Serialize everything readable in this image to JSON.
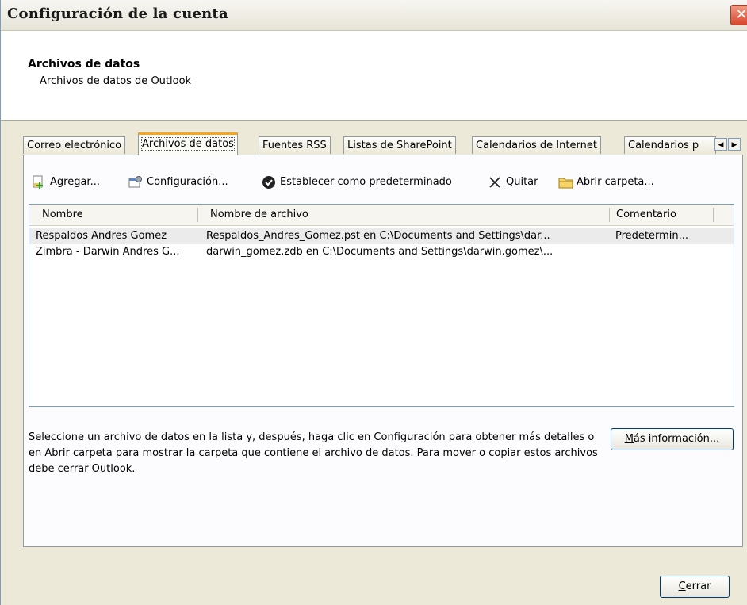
{
  "window": {
    "title": "Configuración de la cuenta",
    "close_glyph": "✕"
  },
  "header": {
    "title": "Archivos de datos",
    "subtitle": "Archivos de datos de Outlook"
  },
  "tabs": [
    {
      "label": "Correo electrónico",
      "active": false
    },
    {
      "label": "Archivos de datos",
      "active": true
    },
    {
      "label": "Fuentes RSS",
      "active": false
    },
    {
      "label": "Listas de SharePoint",
      "active": false
    },
    {
      "label": "Calendarios de Internet",
      "active": false
    },
    {
      "label": "Calendarios p",
      "active": false
    }
  ],
  "tab_scroll": {
    "left_glyph": "◀",
    "right_glyph": "▶"
  },
  "toolbar": {
    "add": {
      "pre": "",
      "u": "A",
      "post": "gregar...",
      "icon": "add-file-icon"
    },
    "settings": {
      "pre": "Co",
      "u": "n",
      "post": "figuración...",
      "icon": "settings-icon"
    },
    "default": {
      "pre": "Establecer como pre",
      "u": "d",
      "post": "eterminado",
      "icon": "checkmark-icon"
    },
    "remove": {
      "pre": "",
      "u": "Q",
      "post": "uitar",
      "icon": "x-icon"
    },
    "open_folder": {
      "pre": "A",
      "u": "b",
      "post": "rir carpeta...",
      "icon": "folder-icon"
    }
  },
  "table": {
    "headers": {
      "name": "Nombre",
      "file": "Nombre de archivo",
      "comment": "Comentario"
    },
    "rows": [
      {
        "name": "Respaldos Andres Gomez",
        "file": "Respaldos_Andres_Gomez.pst en C:\\Documents and Settings\\dar...",
        "comment": "Predetermin..."
      },
      {
        "name": "Zimbra - Darwin Andres G...",
        "file": "darwin_gomez.zdb en C:\\Documents and Settings\\darwin.gomez\\...",
        "comment": ""
      }
    ]
  },
  "info": {
    "text": "Seleccione un archivo de datos en la lista y, después, haga clic en Configuración para obtener más detalles o en Abrir carpeta para mostrar la carpeta que contiene el archivo de datos. Para mover o copiar estos archivos debe cerrar Outlook.",
    "more_btn": {
      "pre": "",
      "u": "M",
      "post": "ás información..."
    }
  },
  "close_button": {
    "pre": "",
    "u": "C",
    "post": "errar"
  }
}
